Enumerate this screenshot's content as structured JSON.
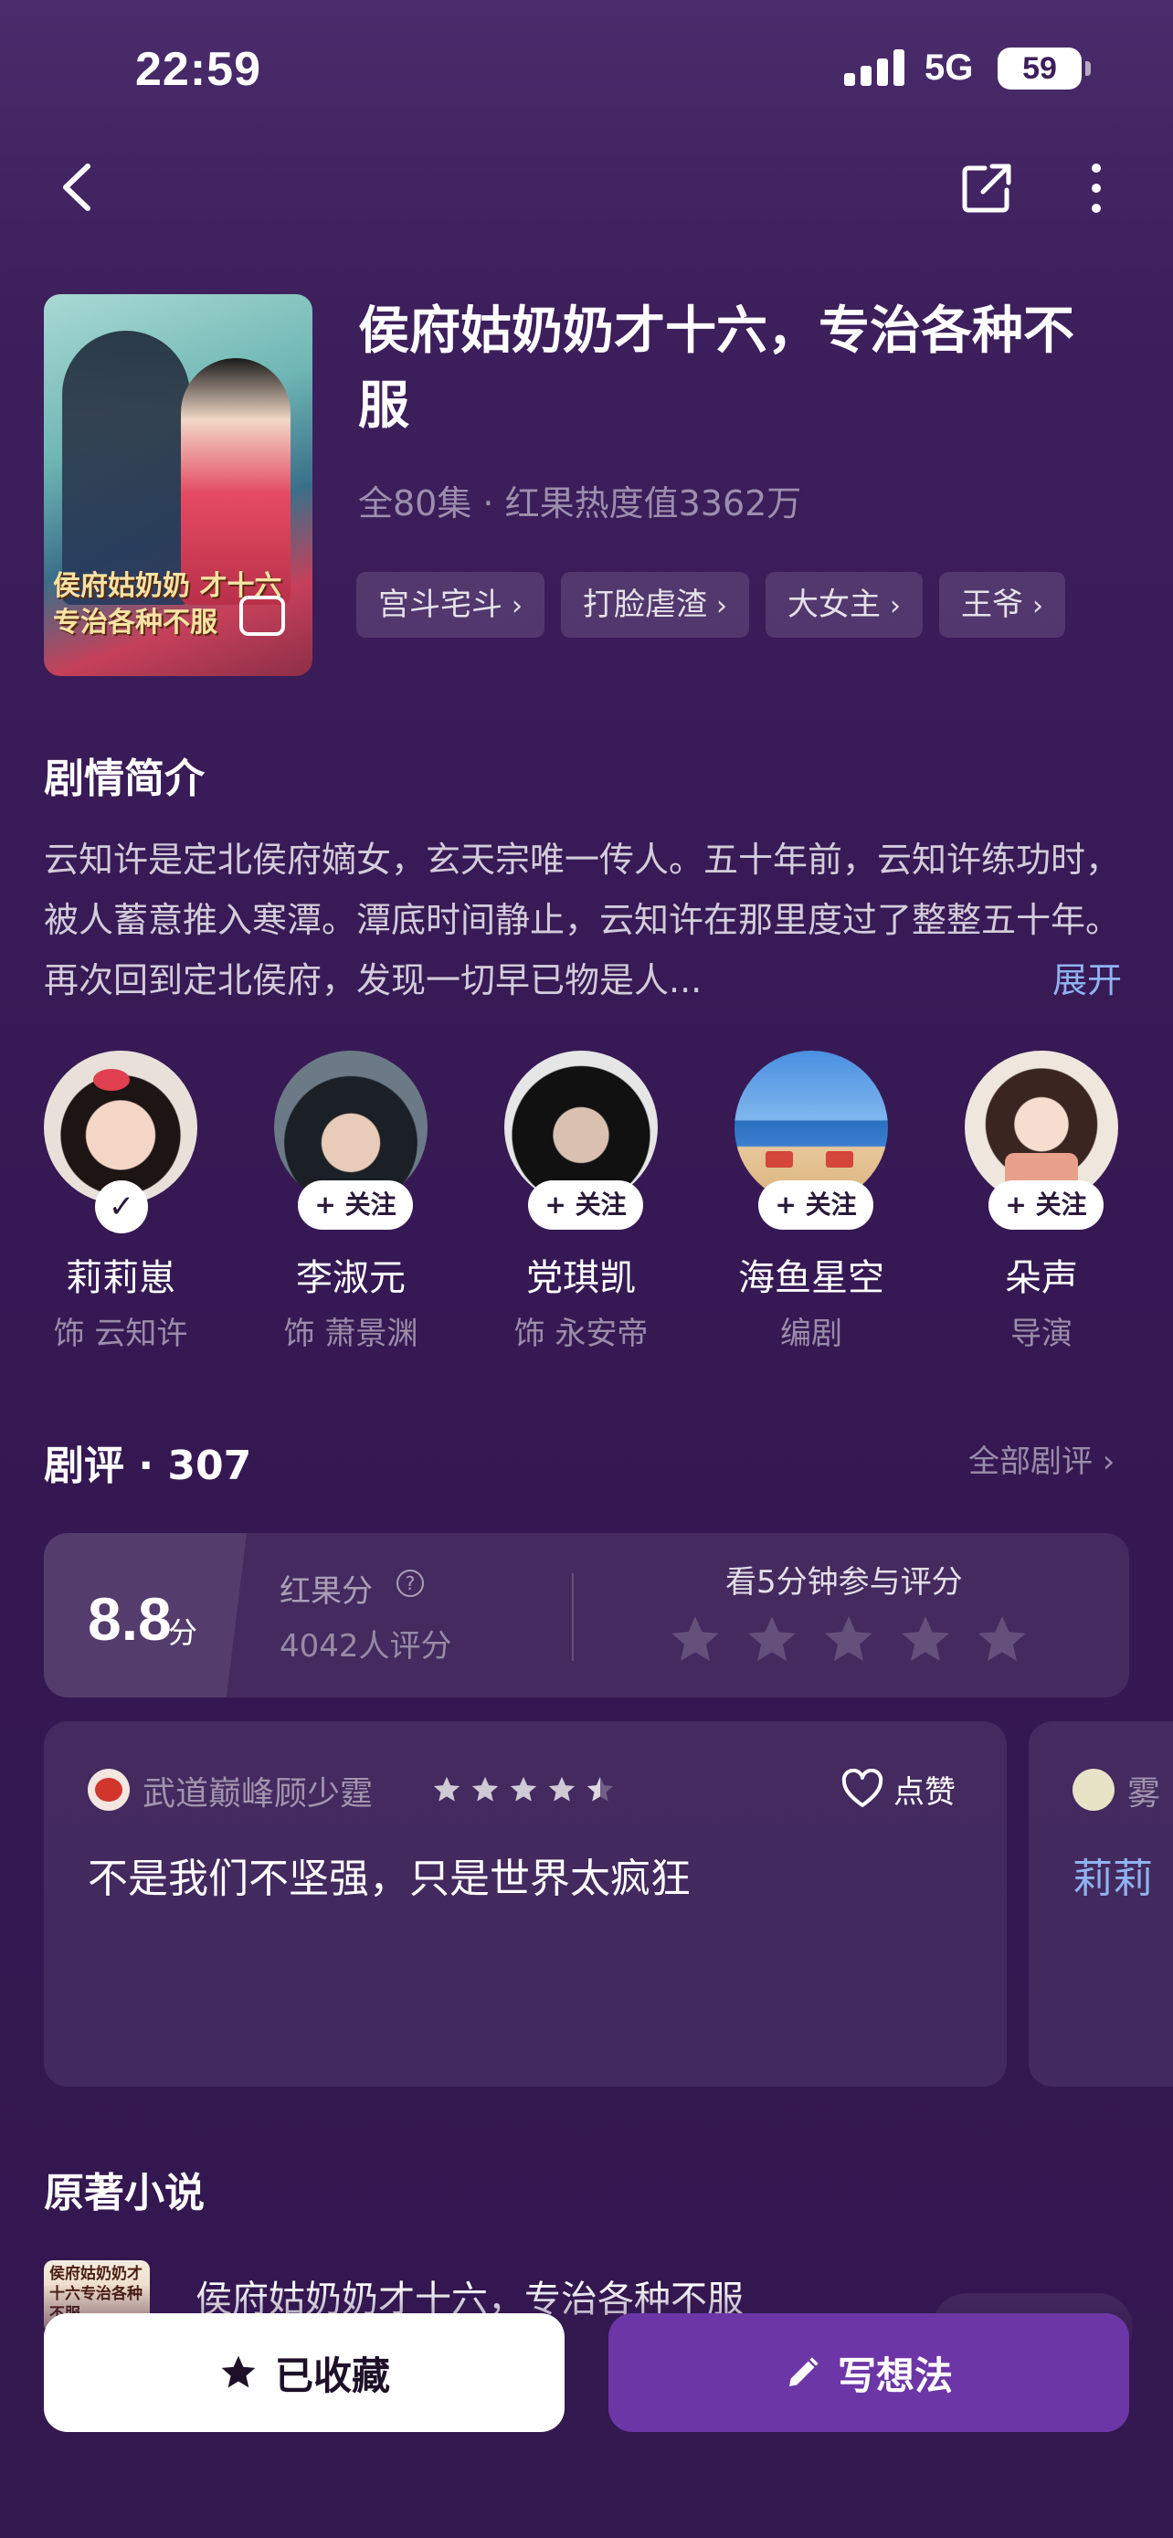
{
  "status_bar": {
    "time": "22:59",
    "network": "5G",
    "battery": "59"
  },
  "nav": {
    "back_icon": "chevron-left-icon",
    "share_icon": "share-icon",
    "more_icon": "more-vertical-icon"
  },
  "drama": {
    "title": "侯府姑奶奶才十六，专治各种不服",
    "meta": "全80集 · 红果热度值3362万",
    "poster_text": "侯府姑奶奶 才十六 专治各种不服",
    "tags": [
      "宫斗宅斗",
      "打脸虐渣",
      "大女主",
      "王爷"
    ]
  },
  "synopsis": {
    "heading": "剧情简介",
    "text": "云知许是定北侯府嫡女，玄天宗唯一传人。五十年前，云知许练功时，被人蓄意推入寒潭。潭底时间静止，云知许在那里度过了整整五十年。再次回到定北侯府，发现一切早已物是人...",
    "expand": "展开"
  },
  "cast": [
    {
      "name": "莉莉崽",
      "role": "饰 云知许",
      "follow": "",
      "followed": true
    },
    {
      "name": "李淑元",
      "role": "饰 萧景渊",
      "follow": "+ 关注",
      "followed": false
    },
    {
      "name": "党琪凯",
      "role": "饰 永安帝",
      "follow": "+ 关注",
      "followed": false
    },
    {
      "name": "海鱼星空",
      "role": "编剧",
      "follow": "+ 关注",
      "followed": false
    },
    {
      "name": "朵声",
      "role": "导演",
      "follow": "+ 关注",
      "followed": false
    }
  ],
  "reviews": {
    "heading": "剧评 · 307",
    "all_link": "全部剧评 ›",
    "score": "8.8",
    "score_unit": "分",
    "score_label": "红果分",
    "rating_count": "4042人评分",
    "rate_prompt": "看5分钟参与评分",
    "items": [
      {
        "user": "武道巅峰顾少霆",
        "stars": 4.5,
        "like_label": "点赞",
        "text": "不是我们不坚强，只是世界太疯狂"
      },
      {
        "user": "雾",
        "text": "莉莉"
      }
    ]
  },
  "novel": {
    "heading": "原著小说",
    "title": "侯府姑奶奶才十六，专治各种不服",
    "subtitle": "在",
    "cover_text": "侯府姑奶奶才十六专治各种不服"
  },
  "bottom_bar": {
    "collect_label": "已收藏",
    "write_label": "写想法"
  },
  "colors": {
    "background": "#3c1d5a",
    "accent_purple": "#6d36a6",
    "link_blue": "#8fb3f0"
  }
}
